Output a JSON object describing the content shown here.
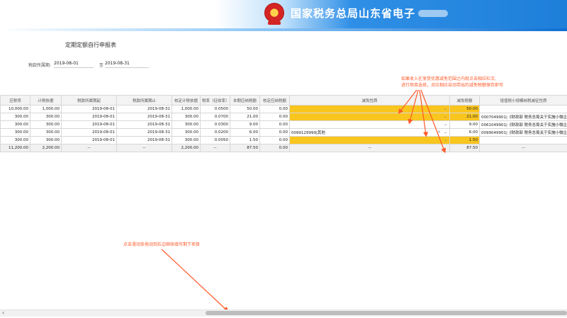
{
  "header": {
    "title": "国家税务总局山东省电子",
    "accent_color": "#1e7fda",
    "emblem_icon": "tax-emblem-icon"
  },
  "form": {
    "title": "定期定额自行申报表",
    "period_label": "税款所属期:",
    "period_from": "2019-08-01",
    "period_sep": "至",
    "period_to": "2019-08-31"
  },
  "table": {
    "columns": [
      "应税项",
      "计税依据",
      "税款所属期起",
      "税款所属期止",
      "核定计税依据",
      "税率（征收率）",
      "本期应纳税额",
      "核定应纳税额",
      "减免性质",
      "减免税额",
      "增值税小规模纳税减征性质"
    ],
    "rows": [
      [
        "10,000.00",
        "1,000.00",
        "2019-08-01",
        "2019-08-31",
        "1,000.00",
        "0.0500",
        "50.00",
        "0.00",
        "",
        "50.00",
        ""
      ],
      [
        "300.00",
        "300.00",
        "2019-08-01",
        "2019-08-31",
        "300.00",
        "0.0700",
        "21.00",
        "0.00",
        "",
        "21.00",
        "0007049901|《财政部 税务总局关于实施小微企"
      ],
      [
        "300.00",
        "300.00",
        "2019-08-01",
        "2019-08-31",
        "300.00",
        "0.0300",
        "9.00",
        "0.00",
        "",
        "9.00",
        "0061049901|《财政部 税务总局关于实施小微企"
      ],
      [
        "300.00",
        "300.00",
        "2019-08-01",
        "2019-08-31",
        "300.00",
        "0.0200",
        "6.00",
        "0.00",
        "0099129999|其他",
        "6.00",
        "0099049901|《财政部 税务总局关于实施小微企"
      ],
      [
        "300.00",
        "300.00",
        "2019-08-01",
        "2019-08-31",
        "300.00",
        "0.0050",
        "1.50",
        "0.00",
        "",
        "1.50",
        ""
      ]
    ],
    "highlighted_rows": [
      0,
      1,
      4
    ],
    "highlight_color": "#f9c51f",
    "totals": [
      "11,200.00",
      "2,200.00",
      "--",
      "--",
      "2,200.00",
      "--",
      "87.50",
      "0.00",
      "--",
      "87.50",
      "--"
    ]
  },
  "annotations": {
    "note_top_line1": "如果收入在享受优惠减免范围之内就点击相应栏次,",
    "note_top_line2": "进行项目选择，对应相应自动带出的减免税额保存即可",
    "note_bottom": "点击滑动条拖动到右边继续填写剩下项目",
    "color": "#ff5a2a"
  },
  "scrollbar": {
    "left_arrow_icon": "chevron-left-icon",
    "position_fraction": 0.36
  }
}
